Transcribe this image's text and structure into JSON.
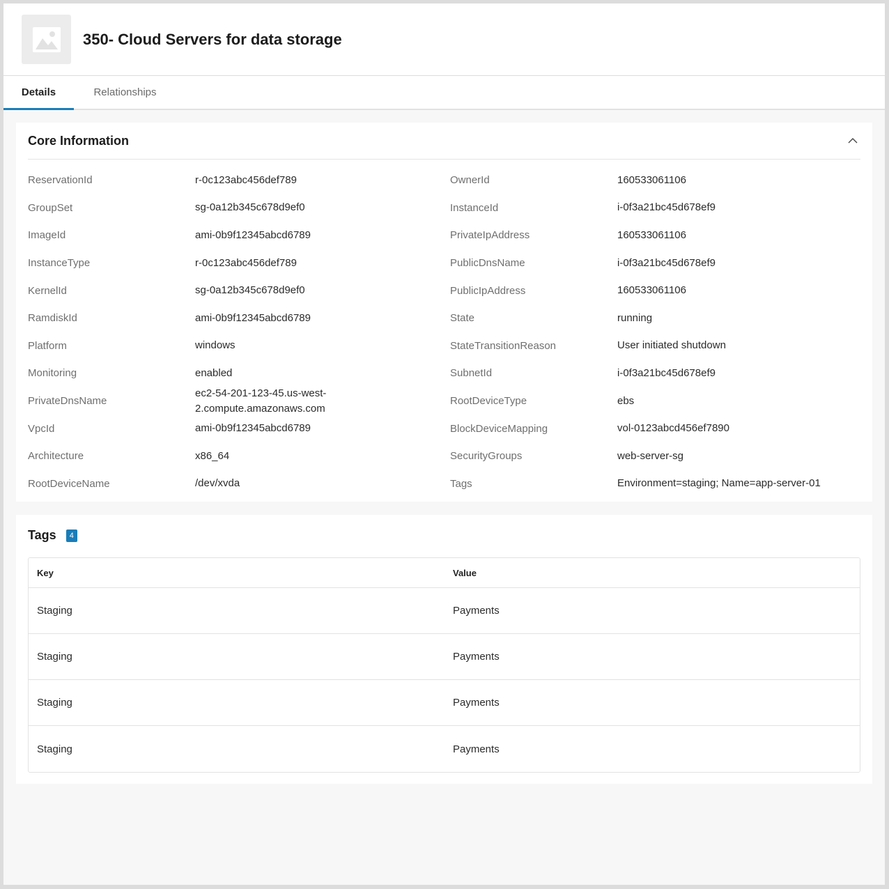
{
  "header": {
    "title": "350- Cloud Servers for data storage",
    "thumbnail_icon": "image-placeholder-icon"
  },
  "tabs": [
    {
      "label": "Details",
      "active": true
    },
    {
      "label": "Relationships",
      "active": false
    }
  ],
  "core": {
    "title": "Core Information",
    "collapse_icon": "chevron-up-icon",
    "rows": [
      {
        "l1": "ReservationId",
        "v1": "r-0c123abc456def789",
        "l2": "OwnerId",
        "v2": "160533061106"
      },
      {
        "l1": "GroupSet",
        "v1": "sg-0a12b345c678d9ef0",
        "l2": "InstanceId",
        "v2": "i-0f3a21bc45d678ef9"
      },
      {
        "l1": "ImageId",
        "v1": "ami-0b9f12345abcd6789",
        "l2": "PrivateIpAddress",
        "v2": "160533061106"
      },
      {
        "l1": "InstanceType",
        "v1": "r-0c123abc456def789",
        "l2": "PublicDnsName",
        "v2": "i-0f3a21bc45d678ef9"
      },
      {
        "l1": "KernelId",
        "v1": "sg-0a12b345c678d9ef0",
        "l2": "PublicIpAddress",
        "v2": "160533061106"
      },
      {
        "l1": "RamdiskId",
        "v1": "ami-0b9f12345abcd6789",
        "l2": "State",
        "v2": "running"
      },
      {
        "l1": "Platform",
        "v1": "windows",
        "l2": "StateTransitionReason",
        "v2": "User initiated shutdown"
      },
      {
        "l1": "Monitoring",
        "v1": "enabled",
        "l2": "SubnetId",
        "v2": "i-0f3a21bc45d678ef9"
      },
      {
        "l1": "PrivateDnsName",
        "v1": "ec2-54-201-123-45.us-west-2.compute.amazonaws.com",
        "l2": "RootDeviceType",
        "v2": "ebs"
      },
      {
        "l1": "VpcId",
        "v1": "ami-0b9f12345abcd6789",
        "l2": "BlockDeviceMapping",
        "v2": "vol-0123abcd456ef7890"
      },
      {
        "l1": "Architecture",
        "v1": "x86_64",
        "l2": "SecurityGroups",
        "v2": "web-server-sg"
      },
      {
        "l1": "RootDeviceName",
        "v1": "/dev/xvda",
        "l2": "Tags",
        "v2": "Environment=staging; Name=app-server-01"
      }
    ]
  },
  "tags": {
    "title": "Tags",
    "count": "4",
    "columns": [
      "Key",
      "Value"
    ],
    "rows": [
      {
        "key": "Staging",
        "value": "Payments"
      },
      {
        "key": "Staging",
        "value": "Payments"
      },
      {
        "key": "Staging",
        "value": "Payments"
      },
      {
        "key": "Staging",
        "value": "Payments"
      }
    ]
  },
  "colors": {
    "accent": "#1a7db8",
    "background": "#f7f7f7"
  }
}
